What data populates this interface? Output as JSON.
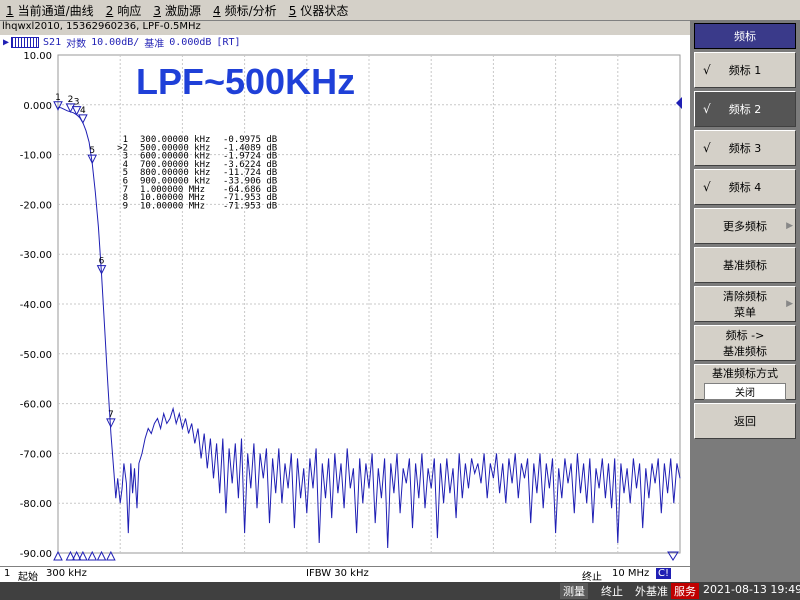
{
  "menu": [
    {
      "num": "1",
      "label": "当前通道/曲线"
    },
    {
      "num": "2",
      "label": "响应"
    },
    {
      "num": "3",
      "label": "激励源"
    },
    {
      "num": "4",
      "label": "频标/分析"
    },
    {
      "num": "5",
      "label": "仪器状态"
    }
  ],
  "title_line": "lhqwxl2010, 15362960236, LPF-0.5MHz",
  "trace": {
    "channel": "S21",
    "format": "对数",
    "scale": "10.00dB/",
    "ref_label": "基准",
    "ref_value": "0.000dB",
    "mode": "[RT]"
  },
  "plot_title": "LPF~500KHz",
  "chart_data": {
    "type": "line",
    "ylim": [
      -90,
      10
    ],
    "yticks": [
      "10.00",
      "0.000",
      "-10.00",
      "-20.00",
      "-30.00",
      "-40.00",
      "-50.00",
      "-60.00",
      "-70.00",
      "-80.00",
      "-90.00"
    ],
    "x_start": "300 kHz",
    "x_stop": "10 MHz",
    "grid": true,
    "series": [
      {
        "points": [
          [
            0.0,
            -0.5
          ],
          [
            0.5,
            -0.6
          ],
          [
            1.0,
            -0.9
          ],
          [
            1.5,
            -1.2
          ],
          [
            2.0,
            -1.4
          ],
          [
            2.5,
            -1.6
          ],
          [
            3.0,
            -2.0
          ],
          [
            3.5,
            -2.6
          ],
          [
            4.0,
            -3.6
          ],
          [
            4.5,
            -5.2
          ],
          [
            5.0,
            -7.5
          ],
          [
            5.5,
            -11.7
          ],
          [
            6.0,
            -17.5
          ],
          [
            6.5,
            -24.5
          ],
          [
            7.0,
            -33.9
          ],
          [
            7.5,
            -45
          ],
          [
            8.0,
            -56
          ],
          [
            8.5,
            -66
          ],
          [
            9.0,
            -74
          ],
          [
            9.3,
            -79
          ],
          [
            9.6,
            -75
          ],
          [
            10.0,
            -80
          ],
          [
            10.3,
            -77
          ],
          [
            10.6,
            -72
          ],
          [
            11.0,
            -76
          ],
          [
            11.3,
            -86
          ],
          [
            11.7,
            -72
          ],
          [
            12.0,
            -78
          ],
          [
            12.3,
            -73
          ],
          [
            12.7,
            -81
          ],
          [
            13.0,
            -72
          ],
          [
            13.5,
            -70
          ],
          [
            14.0,
            -67
          ],
          [
            14.5,
            -65
          ],
          [
            15.0,
            -66
          ],
          [
            15.5,
            -64
          ],
          [
            16.0,
            -63
          ],
          [
            16.5,
            -65
          ],
          [
            17.0,
            -62
          ],
          [
            17.5,
            -64
          ],
          [
            18.0,
            -63
          ],
          [
            18.5,
            -61
          ],
          [
            19.0,
            -64
          ],
          [
            19.5,
            -62
          ],
          [
            20.0,
            -65
          ],
          [
            20.5,
            -63
          ],
          [
            21.0,
            -66
          ],
          [
            21.5,
            -64
          ],
          [
            22.0,
            -68
          ],
          [
            22.5,
            -65
          ],
          [
            23.0,
            -71
          ],
          [
            23.5,
            -66
          ],
          [
            24.0,
            -73
          ],
          [
            24.5,
            -67
          ],
          [
            25.0,
            -75
          ],
          [
            25.5,
            -68
          ],
          [
            26.0,
            -78
          ],
          [
            26.5,
            -67
          ],
          [
            27.0,
            -82
          ],
          [
            27.5,
            -69
          ],
          [
            28.0,
            -76
          ],
          [
            28.5,
            -68
          ],
          [
            29.0,
            -79
          ],
          [
            29.5,
            -67
          ],
          [
            30.0,
            -86
          ],
          [
            30.5,
            -70
          ],
          [
            31.0,
            -77
          ],
          [
            31.5,
            -68
          ],
          [
            32.0,
            -81
          ],
          [
            32.5,
            -70
          ],
          [
            33.0,
            -75
          ],
          [
            33.5,
            -69
          ],
          [
            34.0,
            -84
          ],
          [
            34.5,
            -71
          ],
          [
            35.0,
            -78
          ],
          [
            35.5,
            -69
          ],
          [
            36.0,
            -80
          ],
          [
            36.5,
            -72
          ],
          [
            37.0,
            -77
          ],
          [
            37.5,
            -70
          ],
          [
            38.0,
            -85
          ],
          [
            38.5,
            -71
          ],
          [
            39.0,
            -79
          ],
          [
            39.5,
            -73
          ],
          [
            40.0,
            -82
          ],
          [
            40.5,
            -71
          ],
          [
            41.0,
            -77
          ],
          [
            41.5,
            -69
          ],
          [
            42.0,
            -88
          ],
          [
            42.5,
            -72
          ],
          [
            43.0,
            -79
          ],
          [
            43.5,
            -71
          ],
          [
            44.0,
            -83
          ],
          [
            44.5,
            -70
          ],
          [
            45.0,
            -78
          ],
          [
            45.5,
            -72
          ],
          [
            46.0,
            -81
          ],
          [
            46.5,
            -69
          ],
          [
            47.0,
            -77
          ],
          [
            47.5,
            -73
          ],
          [
            48.0,
            -86
          ],
          [
            48.5,
            -71
          ],
          [
            49.0,
            -80
          ],
          [
            49.5,
            -72
          ],
          [
            50.0,
            -77
          ],
          [
            50.5,
            -70
          ],
          [
            51.0,
            -84
          ],
          [
            51.5,
            -73
          ],
          [
            52.0,
            -79
          ],
          [
            52.5,
            -71
          ],
          [
            53.0,
            -89
          ],
          [
            53.5,
            -72
          ],
          [
            54.0,
            -78
          ],
          [
            54.5,
            -70
          ],
          [
            55.0,
            -82
          ],
          [
            55.5,
            -73
          ],
          [
            56.0,
            -76
          ],
          [
            56.5,
            -71
          ],
          [
            57.0,
            -85
          ],
          [
            57.5,
            -72
          ],
          [
            58.0,
            -79
          ],
          [
            58.5,
            -70
          ],
          [
            59.0,
            -81
          ],
          [
            59.5,
            -73
          ],
          [
            60.0,
            -77
          ],
          [
            60.5,
            -71
          ],
          [
            61.0,
            -87
          ],
          [
            61.5,
            -72
          ],
          [
            62.0,
            -80
          ],
          [
            62.5,
            -71
          ],
          [
            63.0,
            -78
          ],
          [
            63.5,
            -73
          ],
          [
            64.0,
            -83
          ],
          [
            64.5,
            -70
          ],
          [
            65.0,
            -79
          ],
          [
            65.5,
            -72
          ],
          [
            66.0,
            -77
          ],
          [
            66.5,
            -71
          ],
          [
            67.0,
            -74
          ],
          [
            67.5,
            -72
          ],
          [
            68.0,
            -76
          ],
          [
            68.5,
            -70
          ],
          [
            69.0,
            -79
          ],
          [
            69.5,
            -72
          ],
          [
            70.0,
            -75
          ],
          [
            70.5,
            -70
          ],
          [
            71.0,
            -78
          ],
          [
            71.5,
            -72
          ],
          [
            72.0,
            -80
          ],
          [
            72.5,
            -71
          ],
          [
            73.0,
            -76
          ],
          [
            73.5,
            -70
          ],
          [
            74.0,
            -79
          ],
          [
            74.5,
            -72
          ],
          [
            75.0,
            -75
          ],
          [
            75.5,
            -71
          ],
          [
            76.0,
            -84
          ],
          [
            76.5,
            -72
          ],
          [
            77.0,
            -78
          ],
          [
            77.5,
            -70
          ],
          [
            78.0,
            -81
          ],
          [
            78.5,
            -72
          ],
          [
            79.0,
            -77
          ],
          [
            79.5,
            -71
          ],
          [
            80.0,
            -86
          ],
          [
            80.5,
            -73
          ],
          [
            81.0,
            -79
          ],
          [
            81.5,
            -71
          ],
          [
            82.0,
            -76
          ],
          [
            82.5,
            -72
          ],
          [
            83.0,
            -82
          ],
          [
            83.5,
            -70
          ],
          [
            84.0,
            -78
          ],
          [
            84.5,
            -72
          ],
          [
            85.0,
            -80
          ],
          [
            85.5,
            -71
          ],
          [
            86.0,
            -84
          ],
          [
            86.5,
            -73
          ],
          [
            87.0,
            -77
          ],
          [
            87.5,
            -71
          ],
          [
            88.0,
            -79
          ],
          [
            88.5,
            -72
          ],
          [
            89.0,
            -81
          ],
          [
            89.5,
            -71
          ],
          [
            90.0,
            -88
          ],
          [
            90.5,
            -72
          ],
          [
            91.0,
            -78
          ],
          [
            91.5,
            -73
          ],
          [
            92.0,
            -80
          ],
          [
            92.5,
            -71
          ],
          [
            93.0,
            -77
          ],
          [
            93.5,
            -72
          ],
          [
            94.0,
            -85
          ],
          [
            94.5,
            -73
          ],
          [
            95.0,
            -79
          ],
          [
            95.5,
            -72
          ],
          [
            96.0,
            -76
          ],
          [
            96.5,
            -71
          ],
          [
            97.0,
            -82
          ],
          [
            97.5,
            -72
          ],
          [
            98.0,
            -78
          ],
          [
            98.5,
            -71
          ],
          [
            99.0,
            -80
          ],
          [
            99.5,
            -72
          ],
          [
            100,
            -75
          ]
        ]
      }
    ],
    "markers": [
      {
        "n": "1",
        "x": 0.0,
        "y": -0.9975,
        "freq": "300.00000 kHz",
        "value": "-0.9975 dB"
      },
      {
        "n": "2",
        "x": 2.0,
        "y": -1.4089,
        "freq": "500.00000 kHz",
        "value": "-1.4089 dB",
        "active": true
      },
      {
        "n": "3",
        "x": 3.0,
        "y": -1.9724,
        "freq": "600.00000 kHz",
        "value": "-1.9724 dB"
      },
      {
        "n": "4",
        "x": 4.0,
        "y": -3.6224,
        "freq": "700.00000 kHz",
        "value": "-3.6224 dB"
      },
      {
        "n": "5",
        "x": 5.5,
        "y": -11.724,
        "freq": "800.00000 kHz",
        "value": "-11.724 dB"
      },
      {
        "n": "6",
        "x": 7.0,
        "y": -33.906,
        "freq": "900.00000 kHz",
        "value": "-33.906 dB"
      },
      {
        "n": "7",
        "x": 8.5,
        "y": -64.686,
        "freq": "1.000000 MHz",
        "value": "-64.686 dB"
      },
      {
        "n": "8",
        "x": 100,
        "y": -71.953,
        "freq": "10.00000 MHz",
        "value": "-71.953 dB"
      },
      {
        "n": "9",
        "x": 100,
        "y": -71.953,
        "freq": "10.00000 MHz",
        "value": "-71.953 dB"
      }
    ]
  },
  "status": {
    "channel_num": "1",
    "start_label": "起始",
    "start_value": "300 kHz",
    "ifbw": "IFBW 30 kHz",
    "stop_label": "终止",
    "stop_value": "10 MHz",
    "corr": "C!"
  },
  "bottom": {
    "measure": "测量",
    "stop": "终止",
    "ext_ref": "外基准",
    "service": "服务",
    "datetime": "2021-08-13 19:49"
  },
  "softkeys": {
    "title": "频标",
    "marker1": "频标 1",
    "marker2": "频标 2",
    "marker3": "频标 3",
    "marker4": "频标 4",
    "check": "√",
    "more_markers": "更多频标",
    "ref_marker": "基准频标",
    "clear_menu_1": "清除频标",
    "clear_menu_2": "菜单",
    "marker_to_ref_1": "频标 ->",
    "marker_to_ref_2": "基准频标",
    "ref_mode_label": "基准频标方式",
    "ref_mode_value": "关闭",
    "back": "返回"
  }
}
